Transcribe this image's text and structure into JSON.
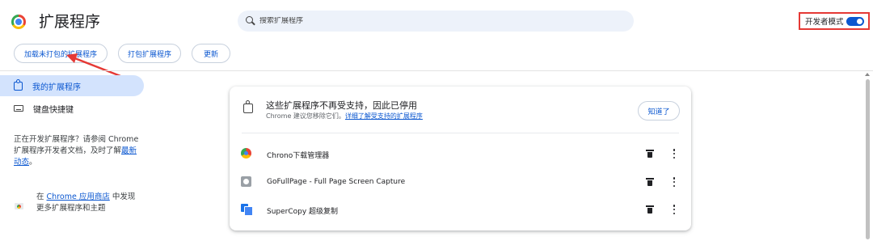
{
  "header": {
    "title": "扩展程序",
    "search_placeholder": "搜索扩展程序",
    "devmode_label": "开发者模式",
    "devmode_on": true
  },
  "toolbar": {
    "load_unpacked": "加载未打包的扩展程序",
    "pack": "打包扩展程序",
    "update": "更新"
  },
  "sidebar": {
    "items": [
      {
        "label": "我的扩展程序",
        "icon": "puzzle-icon",
        "active": true
      },
      {
        "label": "键盘快捷键",
        "icon": "keyboard-icon",
        "active": false
      }
    ],
    "dev_text_prefix": "正在开发扩展程序？请参阅 Chrome 扩展程序开发者文档，及时了解",
    "dev_link": "最新动态",
    "dev_text_suffix": "。",
    "store_prefix": "在 ",
    "store_link": "Chrome 应用商店",
    "store_suffix": " 中发现更多扩展程序和主题"
  },
  "card": {
    "title": "这些扩展程序不再受支持，因此已停用",
    "subtitle_prefix": "Chrome 建议您移除它们。",
    "subtitle_link": "详细了解受支持的扩展程序",
    "got_it": "知道了",
    "extensions": [
      {
        "name": "Chrono下载管理器",
        "icon": "chrono-icon"
      },
      {
        "name": "GoFullPage - Full Page Screen Capture",
        "icon": "camera-icon"
      },
      {
        "name": "SuperCopy 超级复制",
        "icon": "copy-icon"
      }
    ]
  },
  "colors": {
    "accent": "#0b57d0",
    "active_nav_bg": "#d3e3fd",
    "highlight_box": "#e53935"
  }
}
